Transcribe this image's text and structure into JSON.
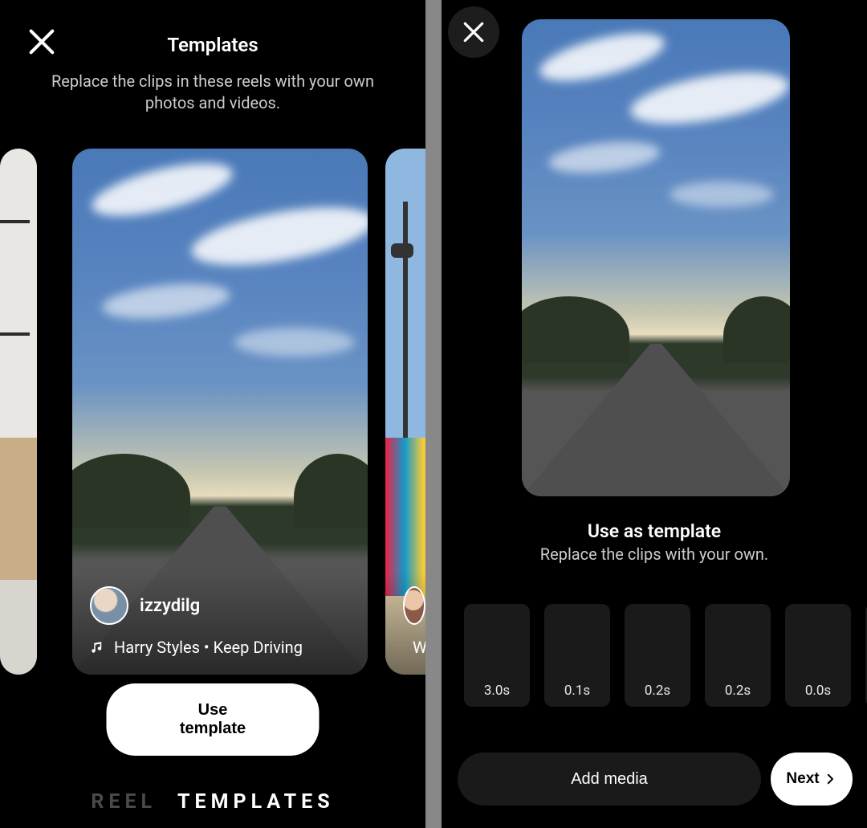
{
  "left": {
    "title": "Templates",
    "subtitle": "Replace the clips in these reels with your own photos and videos.",
    "card": {
      "username": "izzydilg",
      "music": "Harry Styles • Keep Driving"
    },
    "peek_music_initial": "W",
    "use_template_label": "Use template",
    "tabs": {
      "reel": "REEL",
      "templates": "TEMPLATES"
    }
  },
  "right": {
    "title": "Use as template",
    "subtitle": "Replace the clips with your own.",
    "clips": [
      "3.0s",
      "0.1s",
      "0.2s",
      "0.2s",
      "0.0s"
    ],
    "add_media_label": "Add media",
    "next_label": "Next"
  }
}
